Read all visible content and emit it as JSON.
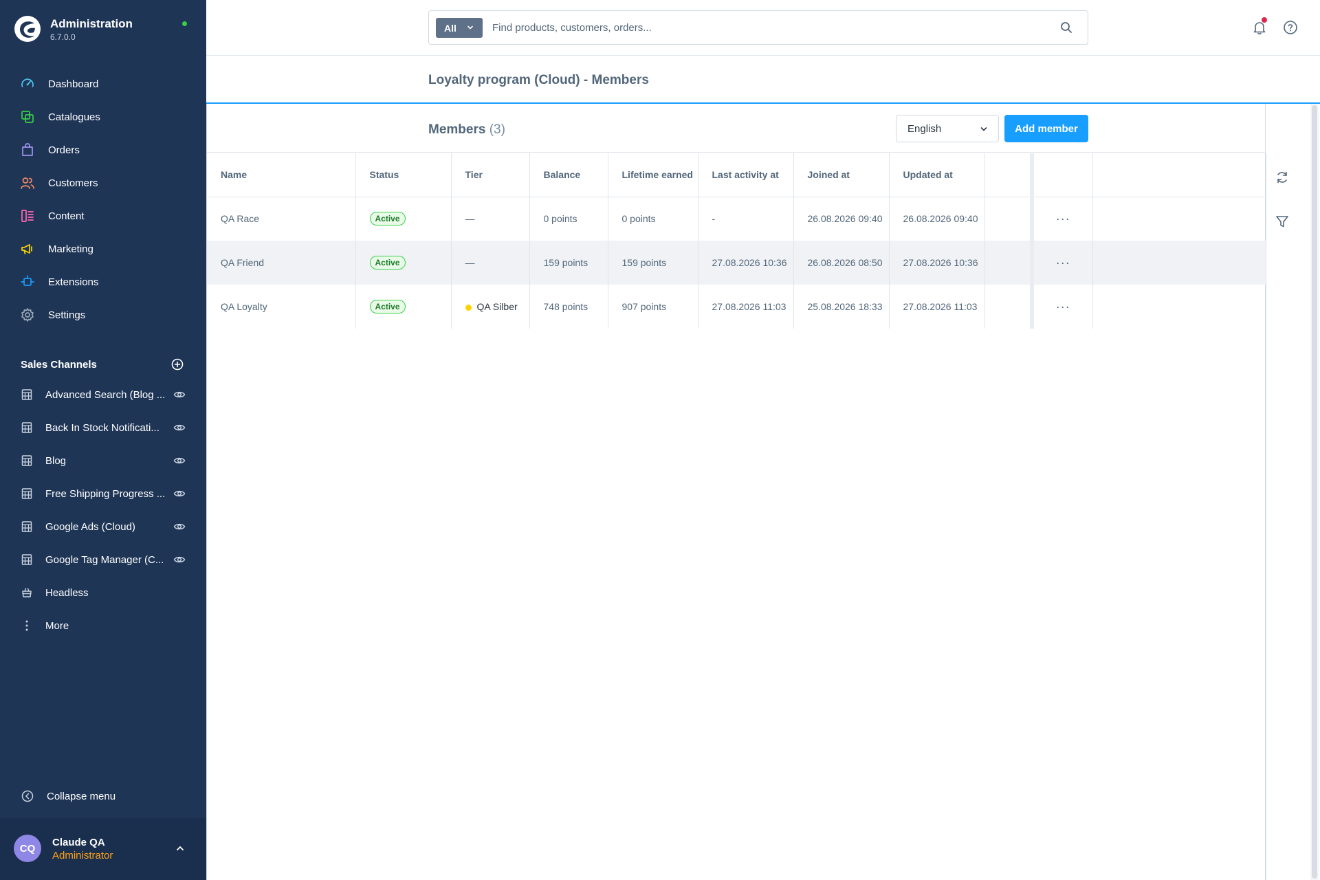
{
  "app": {
    "title": "Administration",
    "version": "6.7.0.0"
  },
  "nav": [
    {
      "id": "dashboard",
      "label": "Dashboard",
      "icon": "dashboard-icon",
      "color": "#4ec7f0"
    },
    {
      "id": "catalogues",
      "label": "Catalogues",
      "icon": "catalogues-icon",
      "color": "#37d046"
    },
    {
      "id": "orders",
      "label": "Orders",
      "icon": "orders-icon",
      "color": "#a092f0"
    },
    {
      "id": "customers",
      "label": "Customers",
      "icon": "customers-icon",
      "color": "#f88962"
    },
    {
      "id": "content",
      "label": "Content",
      "icon": "content-icon",
      "color": "#ff68b4"
    },
    {
      "id": "marketing",
      "label": "Marketing",
      "icon": "marketing-icon",
      "color": "#ffd700"
    },
    {
      "id": "extensions",
      "label": "Extensions",
      "icon": "extensions-icon",
      "color": "#189eff"
    },
    {
      "id": "settings",
      "label": "Settings",
      "icon": "settings-icon",
      "color": "#9aa8b5"
    }
  ],
  "sales_channels": {
    "label": "Sales Channels",
    "items": [
      {
        "label": "Advanced Search (Blog ...",
        "icon": "storefront-icon",
        "eye": true
      },
      {
        "label": "Back In Stock Notificati...",
        "icon": "storefront-icon",
        "eye": true
      },
      {
        "label": "Blog",
        "icon": "storefront-icon",
        "eye": true
      },
      {
        "label": "Free Shipping Progress ...",
        "icon": "storefront-icon",
        "eye": true
      },
      {
        "label": "Google Ads (Cloud)",
        "icon": "storefront-icon",
        "eye": true
      },
      {
        "label": "Google Tag Manager (C...",
        "icon": "storefront-icon",
        "eye": true
      },
      {
        "label": "Headless",
        "icon": "headless-icon",
        "eye": false
      },
      {
        "label": "More",
        "icon": "more-vertical-icon",
        "eye": false
      }
    ]
  },
  "collapse_label": "Collapse menu",
  "user": {
    "initials": "CQ",
    "name": "Claude QA",
    "role": "Administrator"
  },
  "search": {
    "type_label": "All",
    "placeholder": "Find products, customers, orders..."
  },
  "page": {
    "title": "Loyalty program (Cloud) - Members"
  },
  "card": {
    "heading": "Members",
    "count": "(3)",
    "language": "English",
    "add_label": "Add member"
  },
  "table": {
    "columns": [
      "Name",
      "Status",
      "Tier",
      "Balance",
      "Lifetime earned",
      "Last activity at",
      "Joined at",
      "Updated at"
    ],
    "rows": [
      {
        "name": "QA Race",
        "status": "Active",
        "tier": "—",
        "tier_dot": false,
        "balance": "0 points",
        "lifetime": "0 points",
        "last_activity": "-",
        "joined": "26.08.2026 09:40",
        "updated": "26.08.2026 09:40"
      },
      {
        "name": "QA Friend",
        "status": "Active",
        "tier": "—",
        "tier_dot": false,
        "balance": "159 points",
        "lifetime": "159 points",
        "last_activity": "27.08.2026 10:36",
        "joined": "26.08.2026 08:50",
        "updated": "27.08.2026 10:36"
      },
      {
        "name": "QA Loyalty",
        "status": "Active",
        "tier": "QA Silber",
        "tier_dot": true,
        "balance": "748 points",
        "lifetime": "907 points",
        "last_activity": "27.08.2026 11:03",
        "joined": "25.08.2026 18:33",
        "updated": "27.08.2026 11:03"
      }
    ]
  },
  "colors": {
    "sidebar": "#1f3556",
    "primary": "#189eff",
    "status_active": "#37d046",
    "tier_dot": "#ffd200"
  }
}
